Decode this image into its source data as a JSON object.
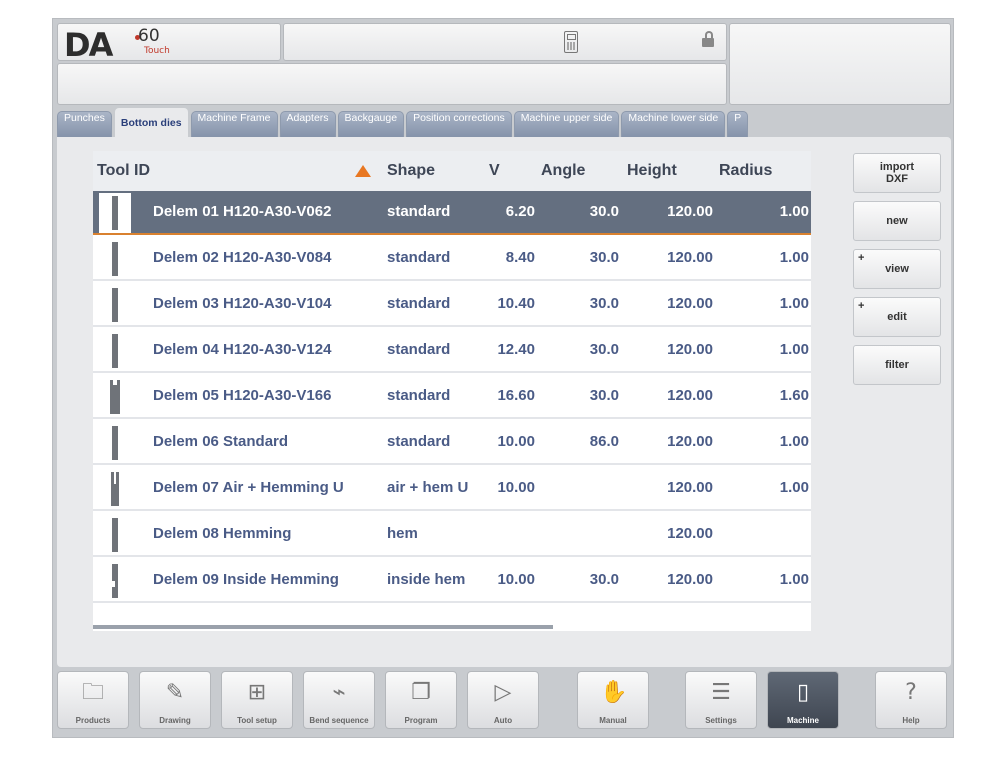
{
  "header": {
    "logo_brand": "DA",
    "logo_model": "60",
    "logo_edition": "Touch"
  },
  "tabs": [
    {
      "label": "Punches",
      "active": false
    },
    {
      "label": "Bottom dies",
      "active": true
    },
    {
      "label": "Machine Frame",
      "active": false
    },
    {
      "label": "Adapters",
      "active": false
    },
    {
      "label": "Backgauge",
      "active": false
    },
    {
      "label": "Position corrections",
      "active": false
    },
    {
      "label": "Machine upper side",
      "active": false
    },
    {
      "label": "Machine lower side",
      "active": false
    },
    {
      "label": "P",
      "active": false
    }
  ],
  "table": {
    "headers": {
      "tool_id": "Tool ID",
      "shape": "Shape",
      "v": "V",
      "angle": "Angle",
      "height": "Height",
      "radius": "Radius"
    },
    "sort_column": "Tool ID",
    "rows": [
      {
        "tool_id": "Delem 01 H120-A30-V062",
        "shape": "standard",
        "v": "6.20",
        "angle": "30.0",
        "height": "120.00",
        "radius": "1.00",
        "selected": true
      },
      {
        "tool_id": "Delem 02 H120-A30-V084",
        "shape": "standard",
        "v": "8.40",
        "angle": "30.0",
        "height": "120.00",
        "radius": "1.00"
      },
      {
        "tool_id": "Delem 03 H120-A30-V104",
        "shape": "standard",
        "v": "10.40",
        "angle": "30.0",
        "height": "120.00",
        "radius": "1.00"
      },
      {
        "tool_id": "Delem 04 H120-A30-V124",
        "shape": "standard",
        "v": "12.40",
        "angle": "30.0",
        "height": "120.00",
        "radius": "1.00"
      },
      {
        "tool_id": "Delem 05 H120-A30-V166",
        "shape": "standard",
        "v": "16.60",
        "angle": "30.0",
        "height": "120.00",
        "radius": "1.60"
      },
      {
        "tool_id": "Delem 06 Standard",
        "shape": "standard",
        "v": "10.00",
        "angle": "86.0",
        "height": "120.00",
        "radius": "1.00"
      },
      {
        "tool_id": "Delem 07 Air + Hemming U",
        "shape": "air + hem U",
        "v": "10.00",
        "angle": "",
        "height": "120.00",
        "radius": "1.00"
      },
      {
        "tool_id": "Delem 08 Hemming",
        "shape": "hem",
        "v": "",
        "angle": "",
        "height": "120.00",
        "radius": ""
      },
      {
        "tool_id": "Delem 09 Inside Hemming",
        "shape": "inside hem",
        "v": "10.00",
        "angle": "30.0",
        "height": "120.00",
        "radius": "1.00"
      }
    ]
  },
  "side_buttons": [
    {
      "label": "import\nDXF",
      "has_plus": false
    },
    {
      "label": "new",
      "has_plus": false
    },
    {
      "label": "view",
      "has_plus": true
    },
    {
      "label": "edit",
      "has_plus": true
    },
    {
      "label": "filter",
      "has_plus": false
    }
  ],
  "bottom_nav": [
    {
      "label": "Products",
      "icon": "folder-icon"
    },
    {
      "label": "Drawing",
      "icon": "drawing-icon"
    },
    {
      "label": "Tool setup",
      "icon": "tool-setup-icon"
    },
    {
      "label": "Bend sequence",
      "icon": "bend-sequence-icon"
    },
    {
      "label": "Program",
      "icon": "program-icon"
    },
    {
      "label": "Auto",
      "icon": "play-icon"
    },
    {
      "label": "Manual",
      "icon": "hand-icon"
    },
    {
      "label": "Settings",
      "icon": "settings-list-icon"
    },
    {
      "label": "Machine",
      "icon": "machine-icon",
      "active": true
    },
    {
      "label": "Help",
      "icon": "help-icon"
    }
  ],
  "colors": {
    "accent": "#e87722",
    "selected_row": "#646f80",
    "row_text": "#4a5b86",
    "tab_inactive": "#8593aa"
  }
}
